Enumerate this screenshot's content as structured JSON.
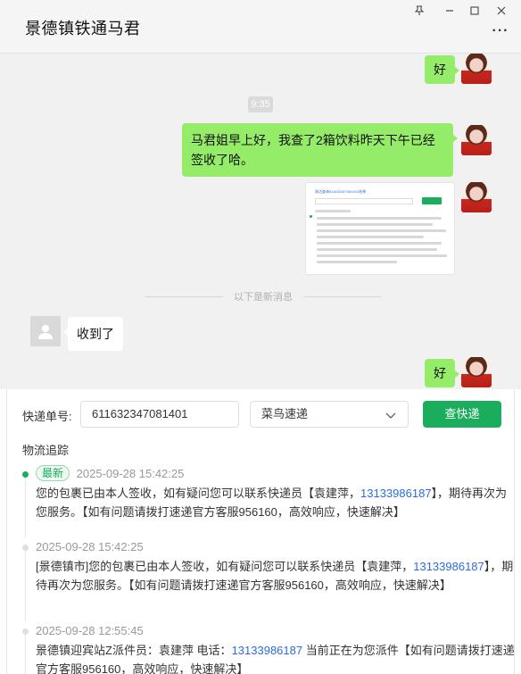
{
  "window": {
    "title": "景德镇铁通马君",
    "pin_icon": "pin-icon",
    "minimize_icon": "minimize-icon",
    "maximize_icon": "maximize-icon",
    "close_icon": "close-icon",
    "more_label": "···"
  },
  "chat": {
    "msg1": "好",
    "time": "9:35",
    "msg2": "马君姐早上好，我查了2箱饮料昨天下午已经签收了哈。",
    "new_divider": "以下是新消息",
    "msg3": "收到了",
    "msg4": "好",
    "screenshot_title": "易达查询611632347081401结果"
  },
  "tracking": {
    "label_no": "快递单号:",
    "tracking_no": "611632347081401",
    "carrier": "菜鸟速递",
    "query_button": "查快递",
    "section_title": "物流追踪",
    "events": [
      {
        "badge": "最新",
        "time": "2025-09-28 15:42:25",
        "text_a": "您的包裹已由本人签收，如有疑问您可以联系快递员【袁建萍，",
        "phone": "13133986187",
        "text_b": "】，期待再次为您服务。【如有问题请拨打速递官方客服956160，高效响应，快速解决】"
      },
      {
        "time": "2025-09-28 15:42:25",
        "text_a": "[景德镇市]您的包裹已由本人签收，如有疑问您可以联系快递员【袁建萍，",
        "phone": "13133986187",
        "text_b": "】，期待再次为您服务。【如有问题请拨打速递官方客服956160，高效响应，快速解决】"
      },
      {
        "time": "2025-09-28 12:55:45",
        "text_a": "景德镇迎宾站Z派件员：袁建萍 电话：",
        "phone": "13133986187",
        "text_b": " 当前正在为您派件【如有问题请拨打速递官方客服956160，高效响应，快速解决】"
      }
    ]
  },
  "colors": {
    "bubble_green": "#95ec69",
    "accent_green": "#1aad5c",
    "phone_blue": "#2d6cdf"
  }
}
